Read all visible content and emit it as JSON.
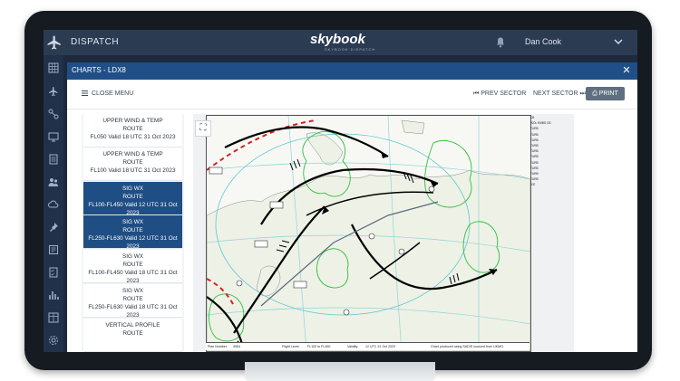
{
  "app": {
    "title": "DISPATCH",
    "logo": "skybook",
    "logo_sub": "SKYBOOK DISPATCH",
    "user": "Dan Cook"
  },
  "modal": {
    "title": "CHARTS - LDX8",
    "close_menu": "CLOSE MENU",
    "prev_sector": "PREV SECTOR",
    "next_sector": "NEXT SECTOR",
    "print": "PRINT"
  },
  "list": [
    {
      "l1": "UPPER WIND & TEMP",
      "l2": "ROUTE",
      "l3": "FL050 Valid 18 UTC 31 Oct 2023",
      "selected": false
    },
    {
      "l1": "UPPER WIND & TEMP",
      "l2": "ROUTE",
      "l3": "FL100 Valid 18 UTC 31 Oct 2023",
      "selected": false
    },
    {
      "l1": "SIG WX",
      "l2": "ROUTE",
      "l3": "FL100-FL450 Valid 12 UTC 31 Oct 2023",
      "selected": true
    },
    {
      "l1": "SIG WX",
      "l2": "ROUTE",
      "l3": "FL250-FL630 Valid 12 UTC 31 Oct 2023",
      "selected": true
    },
    {
      "l1": "SIG WX",
      "l2": "ROUTE",
      "l3": "FL100-FL450 Valid 18 UTC 31 Oct 2023",
      "selected": false
    },
    {
      "l1": "SIG WX",
      "l2": "ROUTE",
      "l3": "FL250-FL630 Valid 18 UTC 31 Oct 2023",
      "selected": false
    },
    {
      "l1": "VERTICAL PROFILE",
      "l2": "ROUTE",
      "l3": "",
      "selected": false
    }
  ],
  "chart_footer": {
    "plan_number": "Plan Number:",
    "plan_number_value": "4954",
    "flight_level": "Flight Level:",
    "flight_level_value": "FL100 to FL450",
    "validity": "Validity:",
    "validity_value": "12 UTC 31 Oct 2023",
    "credit": "Chart produced using SADIS sourced from UKMO."
  },
  "chart_legend": [
    "CB",
    "ISOL EMBD CB",
    "TURB",
    "TURB",
    "TURB",
    "TURB",
    "TURB",
    "TURB",
    "TURB",
    "TURB",
    "TURB",
    "TURB",
    "ICE"
  ],
  "colors": {
    "app_bar": "#2b3b52",
    "modal_header": "#1f4f86",
    "selected_item": "#1f4e84",
    "print_button": "#5f6f80"
  }
}
